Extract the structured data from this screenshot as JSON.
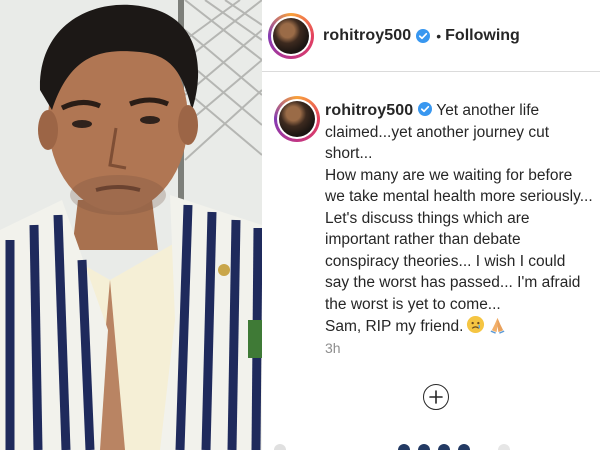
{
  "post": {
    "username": "rohitroy500",
    "follow_status": "Following",
    "separator": "•"
  },
  "comment": {
    "username": "rohitroy500",
    "text": " Yet another life claimed...yet another journey cut short...\nHow many are we waiting for before we take mental health more seriously... Let's discuss things which are important rather than debate conspiracy theories... I wish I could say the worst has passed... I'm afraid the worst is yet to come...\nSam, RIP my friend.",
    "emojis": [
      "sad-face-emoji",
      "folded-hands-emoji"
    ],
    "timestamp": "3h"
  },
  "icons": {
    "verified": "verified-badge-icon",
    "add": "plus-circle-icon"
  },
  "colors": {
    "verified_blue": "#3897f0",
    "ring_gradient": [
      "#f9a23a",
      "#e4405f",
      "#c13584",
      "#833ab4"
    ],
    "secondary_text": "#8e8e8e"
  }
}
